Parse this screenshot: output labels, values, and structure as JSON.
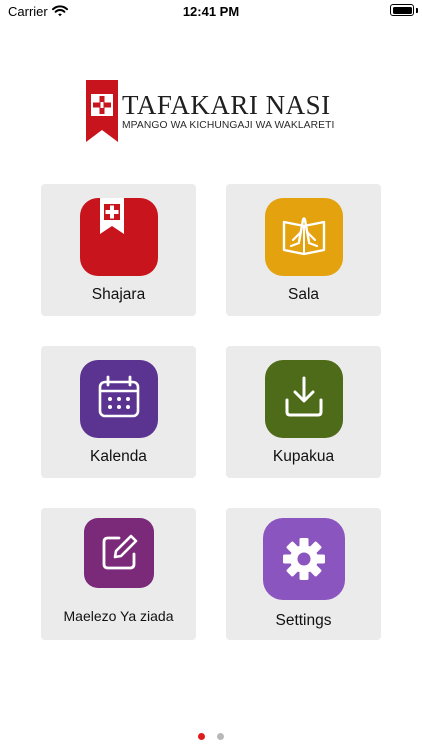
{
  "status_bar": {
    "carrier": "Carrier",
    "time": "12:41 PM"
  },
  "logo": {
    "title": "TAFAKARI NASI",
    "subtitle": "MPANGO WA KICHUNGAJI WA WAKLARETI"
  },
  "menu": [
    {
      "label": "Shajara",
      "icon": "diary-bookmark-icon",
      "color": "#c8141c"
    },
    {
      "label": "Sala",
      "icon": "praying-hands-book-icon",
      "color": "#e3a20e"
    },
    {
      "label": "Kalenda",
      "icon": "calendar-icon",
      "color": "#5b3492"
    },
    {
      "label": "Kupakua",
      "icon": "download-icon",
      "color": "#4d6b18"
    },
    {
      "label": "Maelezo Ya ziada",
      "icon": "edit-note-icon",
      "color": "#7a2a79"
    },
    {
      "label": "Settings",
      "icon": "gear-icon",
      "color": "#8b55c0"
    }
  ],
  "pager": {
    "active_color": "#e01b1b",
    "inactive_color": "#b8b8b8"
  }
}
